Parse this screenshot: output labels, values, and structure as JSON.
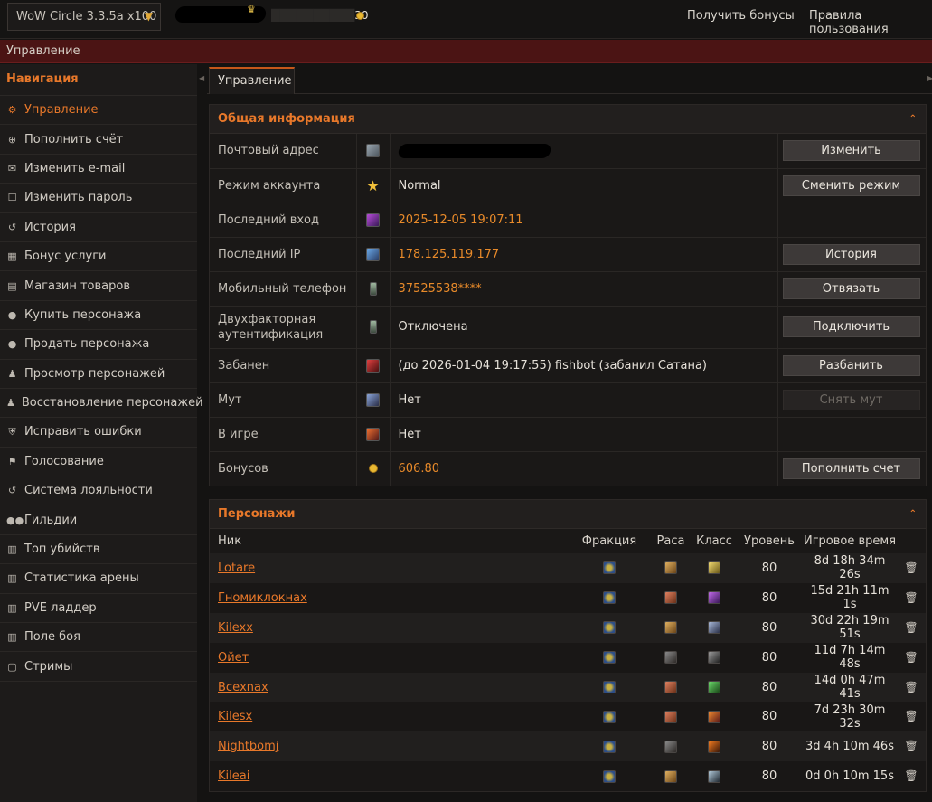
{
  "topbar": {
    "realm": "WoW Circle 3.3.5a x100",
    "balance_visible": "30",
    "links": [
      "Получить бонусы",
      "Правила пользования"
    ]
  },
  "breadcrumb": "Управление",
  "sidebar": {
    "heading": "Навигация",
    "items": [
      {
        "label": "Управление",
        "icon": "gear-icon"
      },
      {
        "label": "Пополнить счёт",
        "icon": "plus-circle-icon"
      },
      {
        "label": "Изменить e-mail",
        "icon": "envelope-icon"
      },
      {
        "label": "Изменить пароль",
        "icon": "lock-icon"
      },
      {
        "label": "История",
        "icon": "history-icon"
      },
      {
        "label": "Бонус услуги",
        "icon": "gift-icon"
      },
      {
        "label": "Магазин товаров",
        "icon": "cart-icon"
      },
      {
        "label": "Купить персонажа",
        "icon": "user-icon"
      },
      {
        "label": "Продать персонажа",
        "icon": "user-icon"
      },
      {
        "label": "Просмотр персонажей",
        "icon": "male-icon"
      },
      {
        "label": "Восстановление персонажей",
        "icon": "male-icon"
      },
      {
        "label": "Исправить ошибки",
        "icon": "shield-icon"
      },
      {
        "label": "Голосование",
        "icon": "flag-icon"
      },
      {
        "label": "Система лояльности",
        "icon": "history-icon"
      },
      {
        "label": "Гильдии",
        "icon": "users-icon"
      },
      {
        "label": "Топ убийств",
        "icon": "chart-icon"
      },
      {
        "label": "Статистика арены",
        "icon": "chart-icon"
      },
      {
        "label": "PVE ладдер",
        "icon": "chart-icon"
      },
      {
        "label": "Поле боя",
        "icon": "chart-icon"
      },
      {
        "label": "Стримы",
        "icon": "twitch-icon"
      }
    ]
  },
  "tab": "Управление",
  "general": {
    "title": "Общая информация",
    "rows": [
      {
        "label": "Почтовый адрес",
        "value": "",
        "button": "Изменить"
      },
      {
        "label": "Режим аккаунта",
        "value": "Normal",
        "button": "Сменить режим"
      },
      {
        "label": "Последний вход",
        "value": "2025-12-05 19:07:11",
        "button": ""
      },
      {
        "label": "Последний IP",
        "value": "178.125.119.177",
        "button": "История"
      },
      {
        "label": "Мобильный телефон",
        "value": "37525538****",
        "button": "Отвязать"
      },
      {
        "label": "Двухфакторная аутентификация",
        "value": "Отключена",
        "button": "Подключить"
      },
      {
        "label": "Забанен",
        "value": "(до 2026-01-04 19:17:55) fishbot (забанил Сатана)",
        "button": "Разбанить"
      },
      {
        "label": "Мут",
        "value": "Нет",
        "button": "Снять мут"
      },
      {
        "label": "В игре",
        "value": "Нет",
        "button": ""
      },
      {
        "label": "Бонусов",
        "value": "606.80",
        "button": "Пополнить счет"
      }
    ]
  },
  "characters": {
    "title": "Персонажи",
    "columns": [
      "Ник",
      "Фракция",
      "Раса",
      "Класс",
      "Уровень",
      "Игровое время"
    ],
    "rows": [
      {
        "name": "Lotare",
        "level": "80",
        "time": "8d 18h 34m 26s"
      },
      {
        "name": "Гномиклокнах",
        "level": "80",
        "time": "15d 21h 11m 1s"
      },
      {
        "name": "Kilexx",
        "level": "80",
        "time": "30d 22h 19m 51s"
      },
      {
        "name": "Ойет",
        "level": "80",
        "time": "11d 7h 14m 48s"
      },
      {
        "name": "Всехnax",
        "level": "80",
        "time": "14d 0h 47m 41s"
      },
      {
        "name": "Kilesx",
        "level": "80",
        "time": "7d 23h 30m 32s"
      },
      {
        "name": "Nightbomj",
        "level": "80",
        "time": "3d 4h 10m 46s"
      },
      {
        "name": "Kileai",
        "level": "80",
        "time": "0d 0h 10m 15s"
      }
    ]
  }
}
